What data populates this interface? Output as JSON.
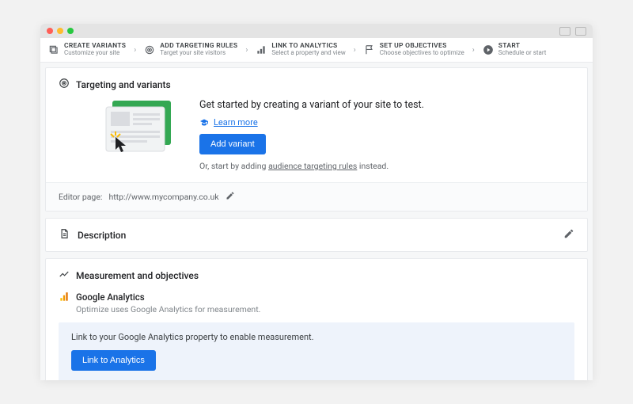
{
  "stepper": {
    "items": [
      {
        "title": "CREATE VARIANTS",
        "sub": "Customize your site"
      },
      {
        "title": "ADD TARGETING RULES",
        "sub": "Target your site visitors"
      },
      {
        "title": "LINK TO ANALYTICS",
        "sub": "Select a property and view"
      },
      {
        "title": "SET UP OBJECTIVES",
        "sub": "Choose objectives to optimize"
      },
      {
        "title": "START",
        "sub": "Schedule or start"
      }
    ]
  },
  "targeting": {
    "section": "Targeting and variants",
    "headline": "Get started by creating a variant of your site to test.",
    "learn": "Learn more",
    "button": "Add variant",
    "hint_before": "Or, start by adding ",
    "hint_link": "audience targeting rules",
    "hint_after": " instead."
  },
  "editor": {
    "label": "Editor page:",
    "url": "http://www.mycompany.co.uk"
  },
  "description": {
    "title": "Description"
  },
  "measurement": {
    "section": "Measurement and objectives",
    "ga_title": "Google Analytics",
    "ga_sub": "Optimize uses Google Analytics for measurement.",
    "callout_text": "Link to your Google Analytics property to enable measurement.",
    "callout_button": "Link to Analytics"
  }
}
